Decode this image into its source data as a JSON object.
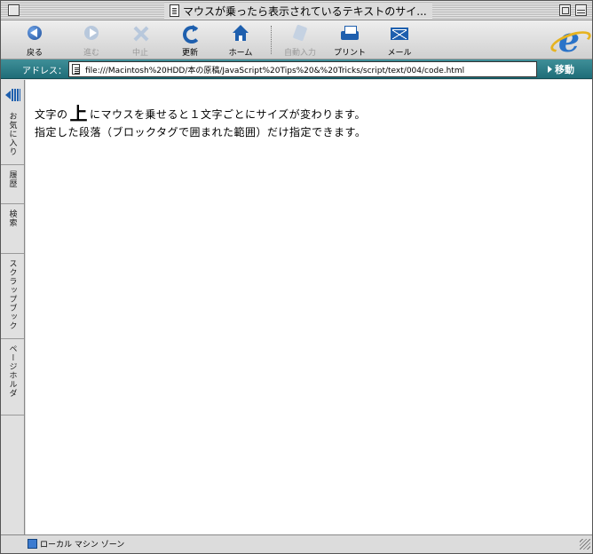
{
  "window": {
    "title": "マウスが乗ったら表示されているテキストのサイ..."
  },
  "toolbar": {
    "buttons": [
      {
        "label": "戻る",
        "icon": "back-arrow-icon",
        "enabled": true
      },
      {
        "label": "進む",
        "icon": "forward-arrow-icon",
        "enabled": false
      },
      {
        "label": "中止",
        "icon": "stop-icon",
        "enabled": false
      },
      {
        "label": "更新",
        "icon": "refresh-icon",
        "enabled": true
      },
      {
        "label": "ホーム",
        "icon": "home-icon",
        "enabled": true
      },
      {
        "label": "自動入力",
        "icon": "autofill-icon",
        "enabled": false
      },
      {
        "label": "プリント",
        "icon": "printer-icon",
        "enabled": true
      },
      {
        "label": "メール",
        "icon": "mail-icon",
        "enabled": true
      }
    ]
  },
  "address": {
    "label": "アドレス：",
    "url": "file:///Macintosh%20HDD/本の原稿/JavaScript%20Tips%20&%20Tricks/script/text/004/code.html",
    "go_label": "移動"
  },
  "explorer_bar": {
    "tabs": [
      "お気に入り",
      "履歴",
      "検索",
      "スクラップブック",
      "ページホルダ"
    ]
  },
  "content": {
    "line1_before": "文字の",
    "line1_big": "上",
    "line1_after": "にマウスを乗せると１文字ごとにサイズが変わります。",
    "line2": "指定した段落（ブロックタグで囲まれた範囲）だけ指定できます。"
  },
  "status": {
    "zone": "ローカル マシン ゾーン"
  },
  "colors": {
    "address_bar": "#1f6d78",
    "accent_blue": "#1e5fae"
  }
}
